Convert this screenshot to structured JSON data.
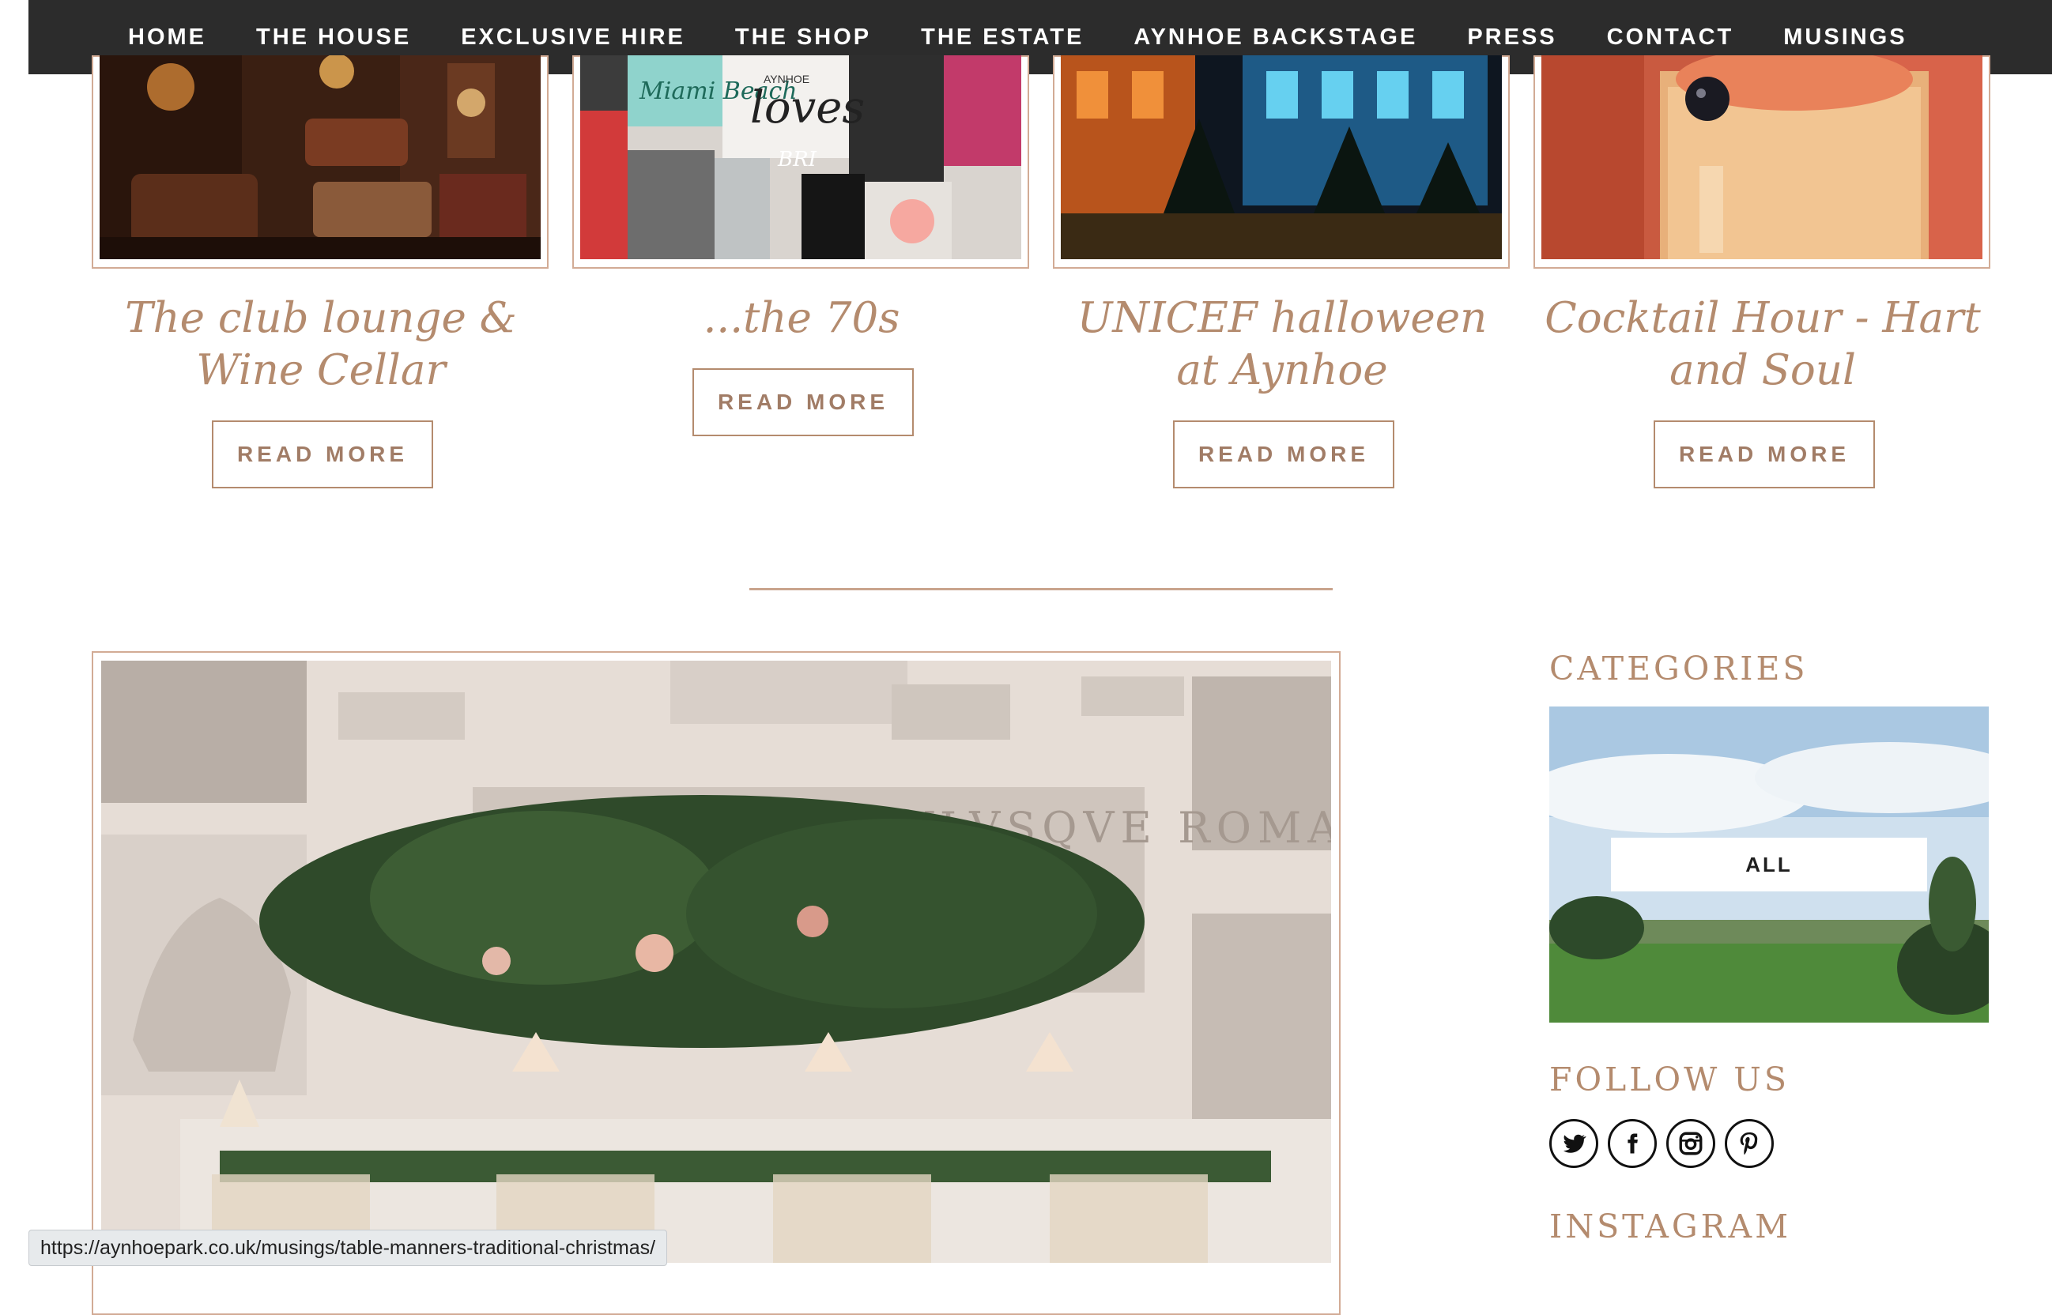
{
  "nav": {
    "items": [
      "HOME",
      "THE HOUSE",
      "EXCLUSIVE HIRE",
      "THE SHOP",
      "THE ESTATE",
      "AYNHOE BACKSTAGE",
      "PRESS",
      "CONTACT",
      "MUSINGS"
    ]
  },
  "posts": [
    {
      "title": "The club lounge & Wine Cellar",
      "button": "READ MORE"
    },
    {
      "title": "...the 70s",
      "button": "READ MORE",
      "collage_text": [
        "Miami Beach",
        "AYNHOE",
        "loves",
        "BRI"
      ]
    },
    {
      "title": "UNICEF halloween at Aynhoe",
      "button": "READ MORE"
    },
    {
      "title": "Cocktail Hour - Hart and Soul",
      "button": "READ MORE"
    }
  ],
  "featured": {
    "inscription": "SENATVS POPVLVSQVE ROMANVS"
  },
  "sidebar": {
    "categories_heading": "CATEGORIES",
    "category_button": "ALL",
    "follow_heading": "FOLLOW US",
    "social_icons": [
      "twitter-icon",
      "facebook-icon",
      "instagram-icon",
      "pinterest-icon"
    ],
    "instagram_heading": "INSTAGRAM"
  },
  "status_bar": {
    "url": "https://aynhoepark.co.uk/musings/table-manners-traditional-christmas/"
  },
  "colors": {
    "accent": "#b48b6e",
    "nav_bg": "#2c2c2c",
    "frame": "#d2ab95"
  }
}
